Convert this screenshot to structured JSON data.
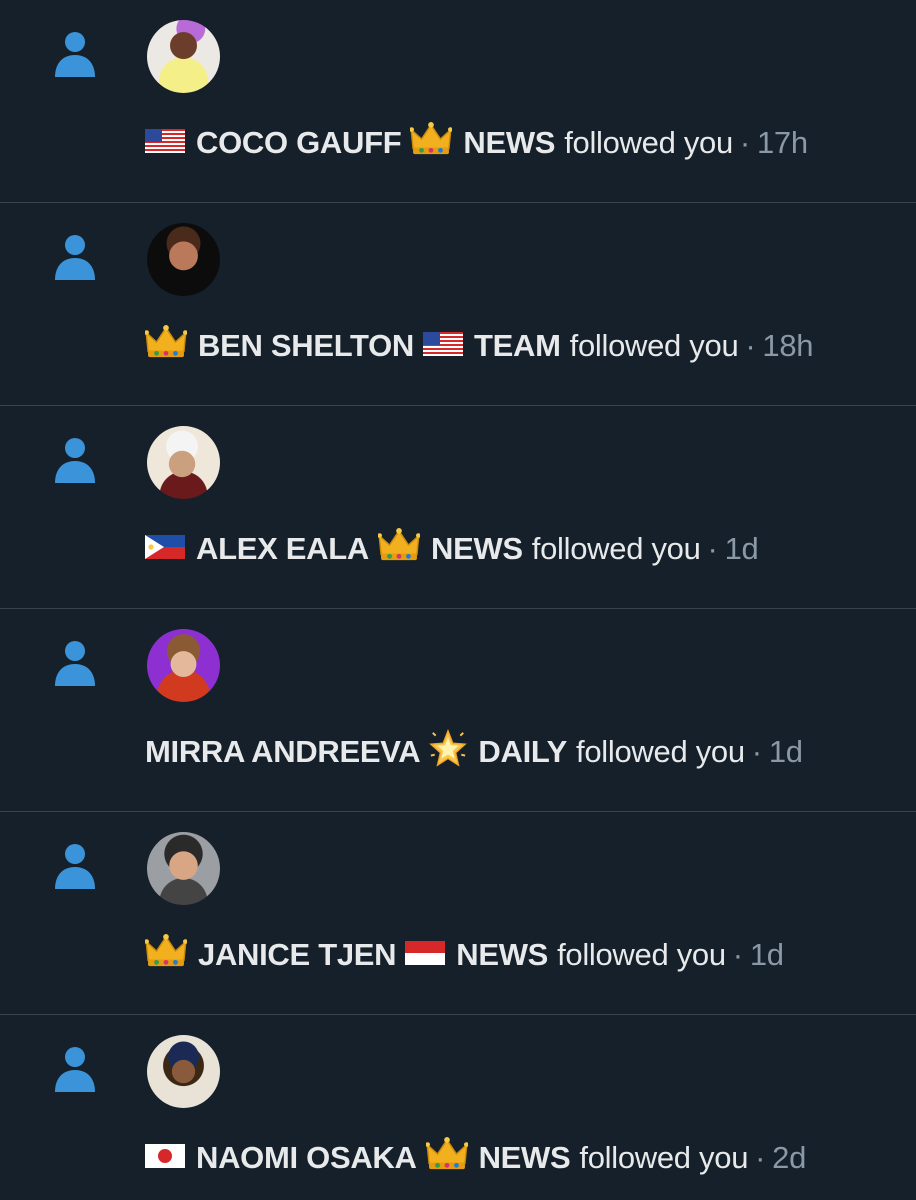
{
  "notifications": [
    {
      "name_prefix": "",
      "name_main": "COCO GAUFF",
      "name_suffix": "NEWS",
      "lead_emoji": "flag-us",
      "mid_emoji": "crown",
      "action": "followed you",
      "separator": "·",
      "time": "17h"
    },
    {
      "name_main": "BEN SHELTON",
      "name_suffix": "TEAM",
      "lead_emoji": "crown",
      "mid_emoji": "flag-us",
      "action": "followed you",
      "separator": "·",
      "time": "18h"
    },
    {
      "name_main": "ALEX EALA",
      "name_suffix": "NEWS",
      "lead_emoji": "flag-ph",
      "mid_emoji": "crown",
      "action": "followed you",
      "separator": "·",
      "time": "1d"
    },
    {
      "name_main": "MIRRA ANDREEVA",
      "name_suffix": "DAILY",
      "lead_emoji": "",
      "mid_emoji": "glowing-star",
      "action": "followed you",
      "separator": "·",
      "time": "1d"
    },
    {
      "name_main": "JANICE TJEN",
      "name_suffix": "NEWS",
      "lead_emoji": "crown",
      "mid_emoji": "flag-id",
      "action": "followed you",
      "separator": "·",
      "time": "1d"
    },
    {
      "name_main": "NAOMI OSAKA",
      "name_suffix": "NEWS",
      "lead_emoji": "flag-jp",
      "mid_emoji": "crown",
      "action": "followed you",
      "separator": "·",
      "time": "2d"
    }
  ],
  "colors": {
    "background": "#15202b",
    "divider": "#38444d",
    "accent_icon": "#3b94d9",
    "text": "#e7e9ea",
    "muted": "#8b98a5"
  }
}
